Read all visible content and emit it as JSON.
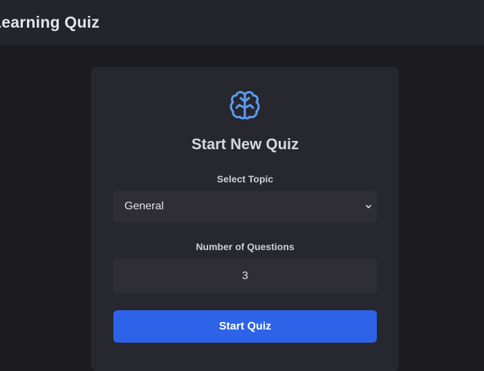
{
  "header": {
    "title": "Learning Quiz"
  },
  "card": {
    "icon": "brain-icon",
    "title": "Start New Quiz",
    "topic_label": "Select Topic",
    "topic_selected": "General",
    "count_label": "Number of Questions",
    "count_value": "3",
    "start_label": "Start Quiz"
  },
  "colors": {
    "accent": "#2d63e8",
    "icon": "#5b9cf0",
    "background": "#1b1b20",
    "card": "#27272f",
    "field": "#2f2e37"
  }
}
